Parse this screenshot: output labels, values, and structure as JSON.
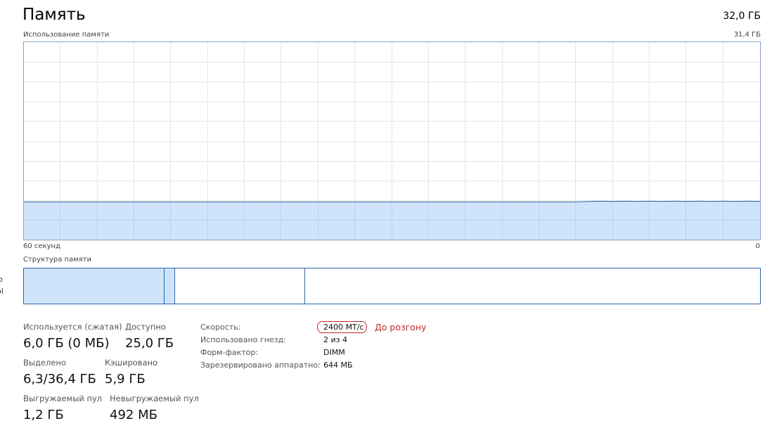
{
  "header": {
    "title": "Память",
    "total": "32,0 ГБ",
    "usage_label": "Использование памяти",
    "usage_max": "31,4 ГБ"
  },
  "graph": {
    "axis_left": "60 секунд",
    "axis_right": "0",
    "fill_color": "#cfe4fb",
    "line_color": "#2f66a6",
    "grid_color": "#e6e6e6",
    "usage_gb": 6.0,
    "max_gb": 31.4
  },
  "structure": {
    "label": "Структура памяти"
  },
  "stats": {
    "in_use_label": "Используется (сжатая)",
    "in_use_value": "6,0 ГБ (0 МБ)",
    "available_label": "Доступно",
    "available_value": "25,0 ГБ",
    "committed_label": "Выделено",
    "committed_value": "6,3/36,4 ГБ",
    "cached_label": "Кэшировано",
    "cached_value": "5,9 ГБ",
    "paged_label": "Выгружаемый пул",
    "paged_value": "1,2 ГБ",
    "nonpaged_label": "Невыгружаемый пул",
    "nonpaged_value": "492 МБ"
  },
  "details": {
    "speed_label": "Скорость:",
    "speed_value": "2400 МТ/с",
    "slots_label": "Использовано гнезд:",
    "slots_value": "2 из 4",
    "form_label": "Форм-фактор:",
    "form_value": "DIMM",
    "reserved_label": "Зарезервировано аппаратно:",
    "reserved_value": "644 МБ",
    "annotation": "До розгону"
  },
  "edge": {
    "frag1": "о",
    "frag2": "ol"
  }
}
